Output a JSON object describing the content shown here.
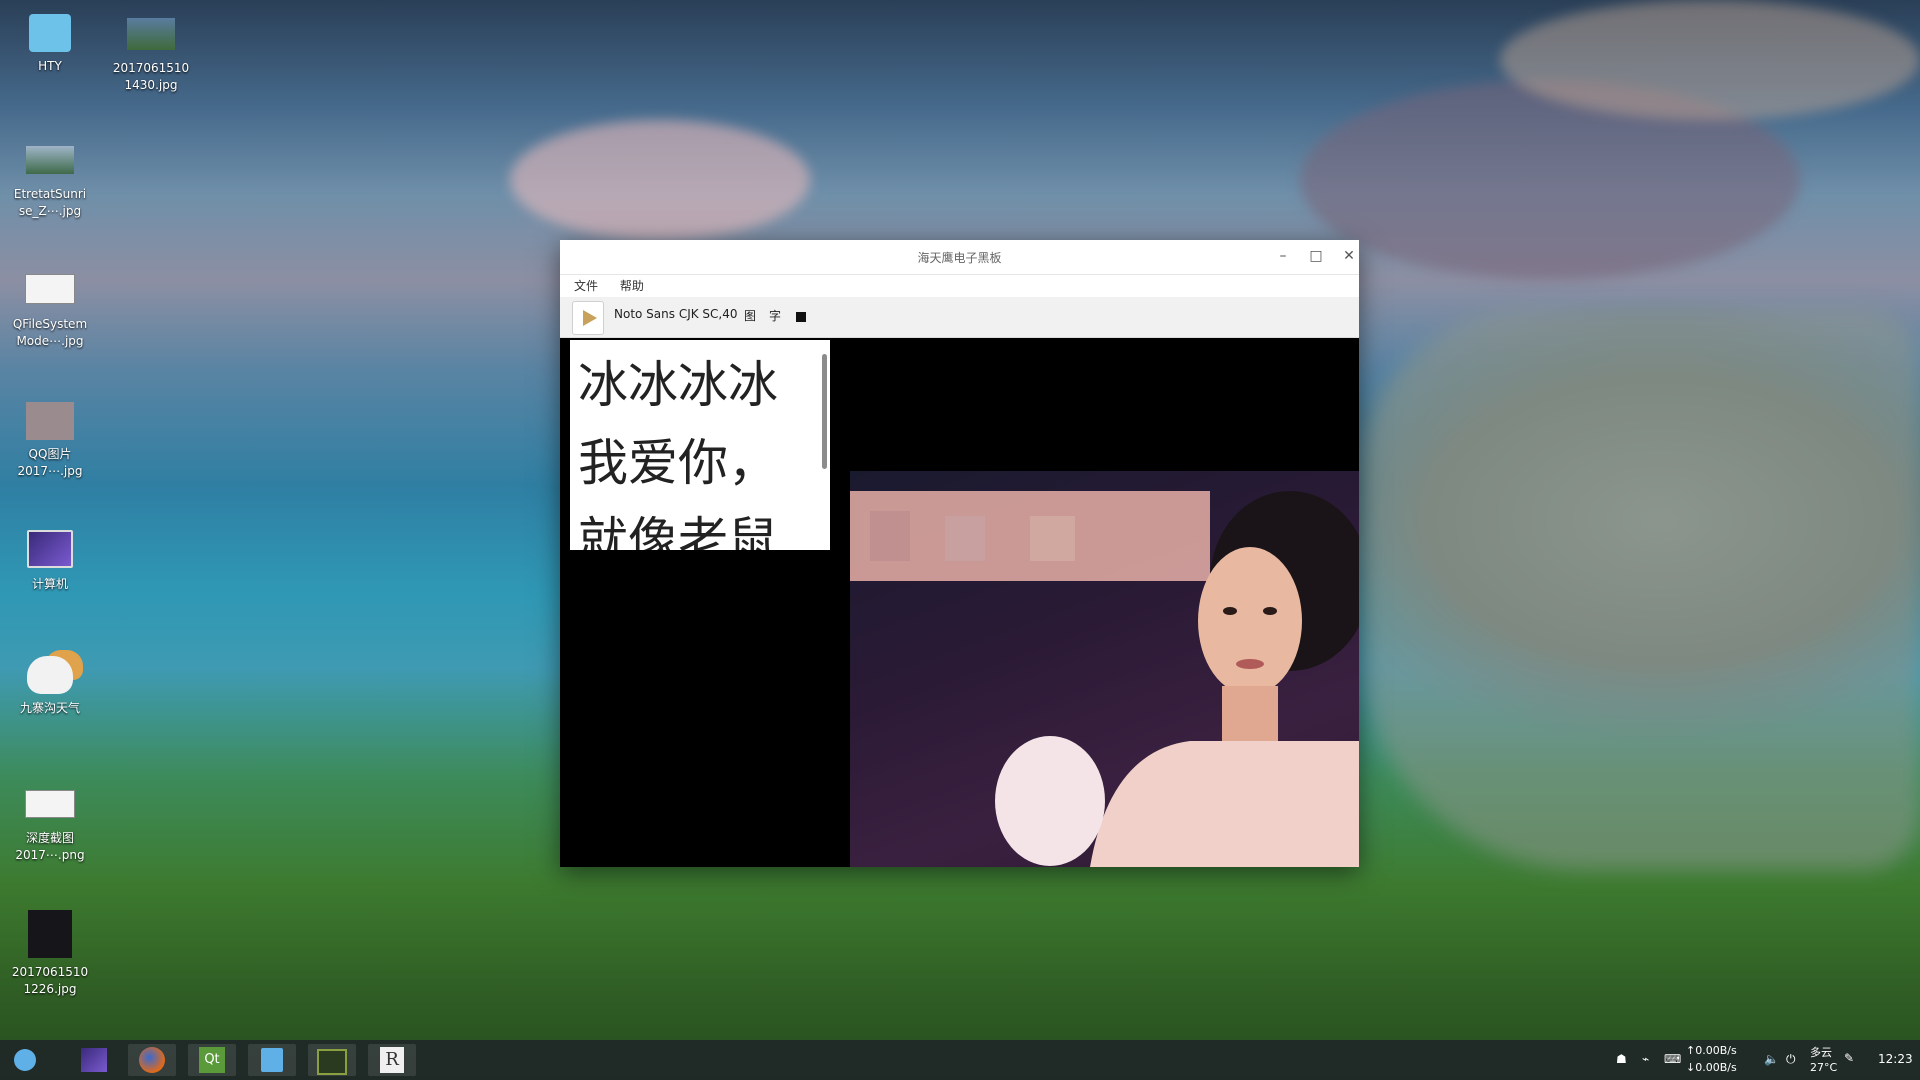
{
  "desktop": {
    "icons": [
      {
        "label": "HTY",
        "kind": "folder"
      },
      {
        "label": "2017061510\n1430.jpg",
        "kind": "image"
      },
      {
        "label": "EtretatSunri\nse_Z⋯.jpg",
        "kind": "image"
      },
      {
        "label": "QFileSystem\nMode⋯.jpg",
        "kind": "image"
      },
      {
        "label": "QQ图片\n2017⋯.jpg",
        "kind": "image"
      },
      {
        "label": "计算机",
        "kind": "computer"
      },
      {
        "label": "九寨沟天气",
        "kind": "weather"
      },
      {
        "label": "深度截图\n2017⋯.png",
        "kind": "image"
      },
      {
        "label": "2017061510\n1226.jpg",
        "kind": "image"
      }
    ]
  },
  "window": {
    "title": "海天鹰电子黑板",
    "controls": {
      "minimize": "–",
      "maximize": "□",
      "close": "✕"
    },
    "menu": [
      "文件",
      "帮助"
    ],
    "toolbar": {
      "play_icon": "play-icon",
      "font_label": "Noto Sans CJK SC,40",
      "image_button": "图",
      "text_button": "字",
      "color_swatch": "#111111"
    },
    "text_content": "冰冰冰冰\n我爱你，\n就像老鼠"
  },
  "taskbar": {
    "apps": [
      "launcher-icon",
      "deepin-icon",
      "firefox-icon",
      "qt-creator-icon",
      "store-icon",
      "monitor-icon",
      "r-icon"
    ],
    "net_up": "↑0.00B/s",
    "net_down": "↓0.00B/s",
    "weather": "多云",
    "temperature": "27°C",
    "time": "12:23"
  }
}
